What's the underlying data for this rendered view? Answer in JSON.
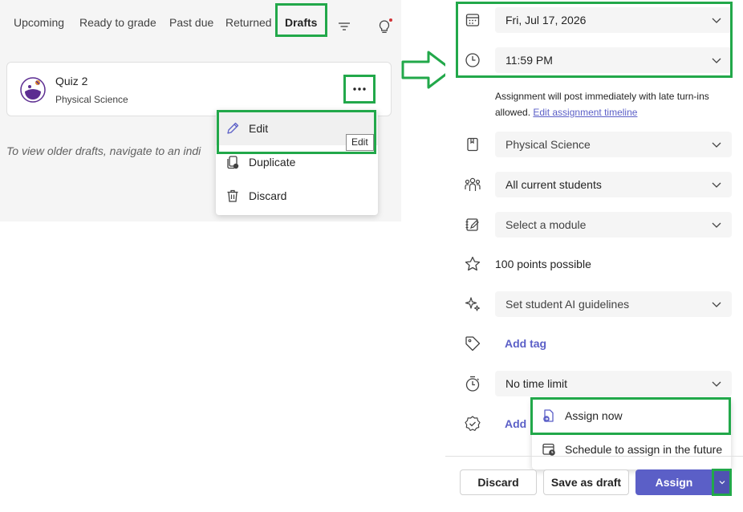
{
  "tabs": [
    {
      "label": "Upcoming"
    },
    {
      "label": "Ready to grade"
    },
    {
      "label": "Past due"
    },
    {
      "label": "Returned"
    },
    {
      "label": "Drafts",
      "active": true
    }
  ],
  "toolbar_icons": [
    "filter-icon",
    "lightbulb-icon"
  ],
  "draft_card": {
    "title": "Quiz 2",
    "subtitle": "Physical Science"
  },
  "hint_text": "To view older drafts, navigate to an indi",
  "context_menu": {
    "items": [
      {
        "label": "Edit",
        "icon": "pencil-icon"
      },
      {
        "label": "Duplicate",
        "icon": "duplicate-icon"
      },
      {
        "label": "Discard",
        "icon": "trash-icon"
      }
    ],
    "tooltip": "Edit"
  },
  "assignment": {
    "due_date": "Fri, Jul 17, 2026",
    "due_time": "11:59 PM",
    "note_text": "Assignment will post immediately with late turn-ins allowed.",
    "note_link": "Edit assignment timeline",
    "class": "Physical Science",
    "students": "All current students",
    "module_placeholder": "Select a module",
    "points": "100 points possible",
    "ai_guidelines": "Set student AI guidelines",
    "add_tag": "Add tag",
    "time_limit": "No time limit",
    "add_partial": "Add"
  },
  "assign_menu": {
    "items": [
      {
        "label": "Assign now",
        "icon": "assign-now-icon"
      },
      {
        "label": "Schedule to assign in the future",
        "icon": "schedule-icon"
      }
    ]
  },
  "footer": {
    "discard": "Discard",
    "save_draft": "Save as draft",
    "assign": "Assign"
  },
  "colors": {
    "highlight": "#22a84a",
    "accent": "#5b5fc7",
    "field_bg": "#f5f5f5",
    "notification_dot": "#d13438"
  }
}
